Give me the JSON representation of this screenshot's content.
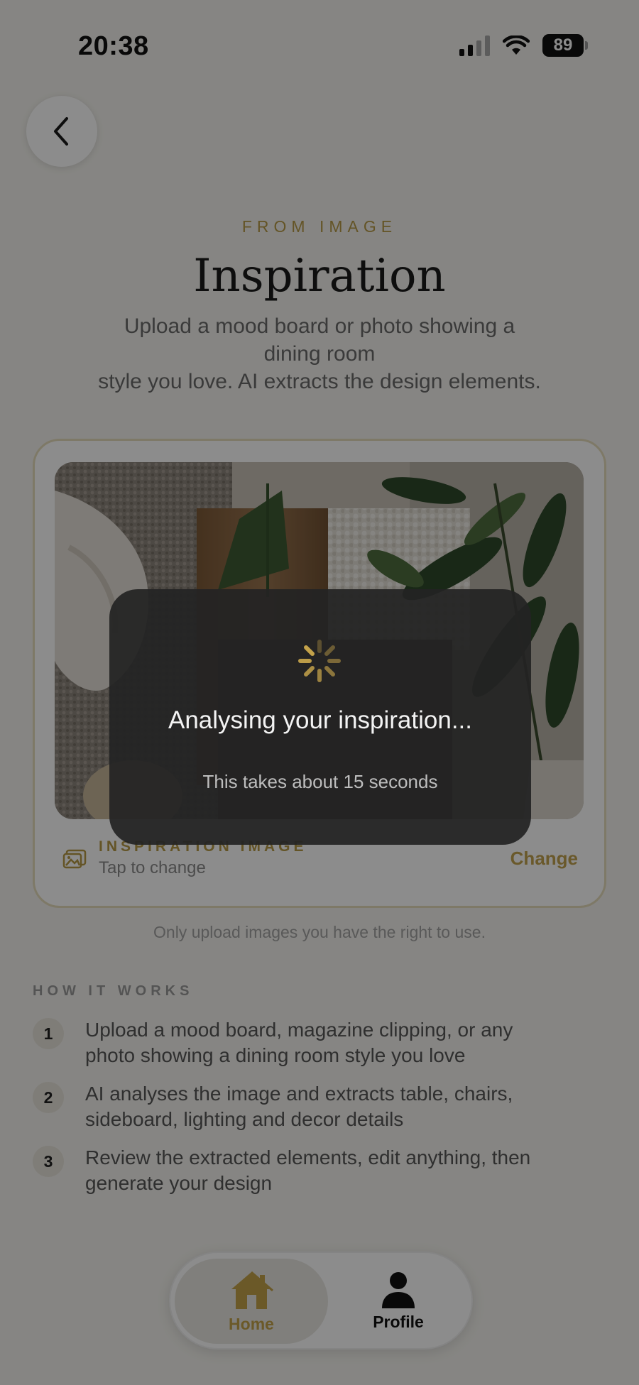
{
  "status_bar": {
    "time": "20:38",
    "battery": "89"
  },
  "header": {
    "eyebrow": "FROM IMAGE",
    "title": "Inspiration",
    "subtitle_lines": [
      "Upload a mood board or photo showing a",
      "dining room",
      "style you love. AI extracts the design elements."
    ]
  },
  "upload": {
    "label": "INSPIRATION IMAGE",
    "hint": "Tap to change",
    "change_label": "Change",
    "rights_note": "Only upload images you have the right to use."
  },
  "how_it_works": {
    "heading": "HOW IT WORKS",
    "steps": [
      {
        "number": "1",
        "lines": [
          "Upload a mood board, magazine clipping, or any",
          "photo showing a dining room style you love"
        ]
      },
      {
        "number": "2",
        "lines": [
          "AI analyses the image and extracts table, chairs,",
          "sideboard, lighting and decor details"
        ]
      },
      {
        "number": "3",
        "lines": [
          "Review the extracted elements, edit anything, then",
          "generate your design"
        ]
      }
    ]
  },
  "loading": {
    "title": "Analysing your inspiration...",
    "subtitle": "This takes about 15 seconds"
  },
  "tabbar": {
    "home_label": "Home",
    "profile_label": "Profile"
  },
  "colors": {
    "accent_gold": "#c4a24a",
    "background": "#f4f3ee",
    "overlay": "rgba(0,0,0,0.45)"
  },
  "icons": {
    "back": "chevron-left-icon",
    "image": "image-icon",
    "spinner": "spinner-icon",
    "home": "house-icon",
    "profile": "person-icon"
  }
}
